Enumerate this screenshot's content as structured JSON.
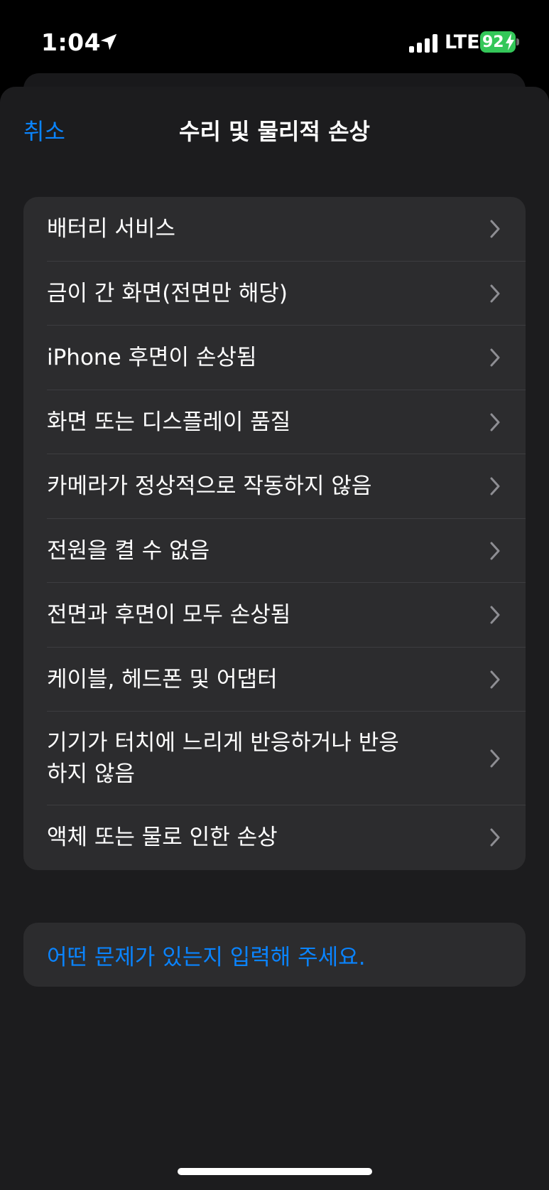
{
  "status_bar": {
    "time": "1:04",
    "network": "LTE",
    "battery": "92"
  },
  "nav": {
    "cancel_label": "취소",
    "title": "수리 및 물리적 손상"
  },
  "options": [
    {
      "label": "배터리 서비스"
    },
    {
      "label": "금이 간 화면(전면만 해당)"
    },
    {
      "label": "iPhone 후면이 손상됨"
    },
    {
      "label": "화면 또는 디스플레이 품질"
    },
    {
      "label": "카메라가 정상적으로 작동하지 않음"
    },
    {
      "label": "전원을 켤 수 없음"
    },
    {
      "label": "전면과 후면이 모두 손상됨"
    },
    {
      "label": "케이블, 헤드폰 및 어댑터"
    },
    {
      "label": "기기가 터치에 느리게 반응하거나 반응\n하지 않음"
    },
    {
      "label": "액체 또는 물로 인한 손상"
    }
  ],
  "describe": {
    "label": "어떤 문제가 있는지 입력해 주세요."
  },
  "colors": {
    "accent": "#0a84ff",
    "background": "#000000",
    "sheet": "#1c1c1e",
    "group": "#2c2c2e",
    "battery": "#34c759"
  },
  "icons": [
    "location-arrow-icon",
    "cellular-signal-icon",
    "battery-icon",
    "charging-bolt-icon",
    "chevron-right-icon"
  ]
}
